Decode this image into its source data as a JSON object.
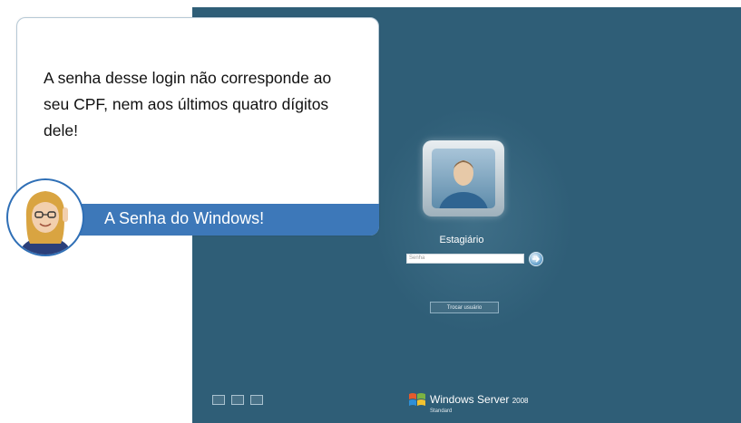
{
  "callout": {
    "text": "A senha desse login não corresponde ao seu CPF, nem aos últimos quatro dígitos dele!",
    "banner": "A Senha do Windows!"
  },
  "login": {
    "username": "Estagiário",
    "password_placeholder": "Senha",
    "switch_user_label": "Trocar usuário"
  },
  "branding": {
    "product": "Windows Server",
    "year": "2008",
    "edition": "Standard"
  },
  "icons": {
    "avatar": "user-avatar-icon",
    "go": "arrow-right-icon",
    "ease_of_access": "ease-of-access-icon",
    "mascot": "mascot-girl-icon",
    "windows": "windows-flag-icon"
  },
  "colors": {
    "desktop": "#2f5e77",
    "banner": "#3d78b9",
    "card_border": "#b6c9d6"
  }
}
